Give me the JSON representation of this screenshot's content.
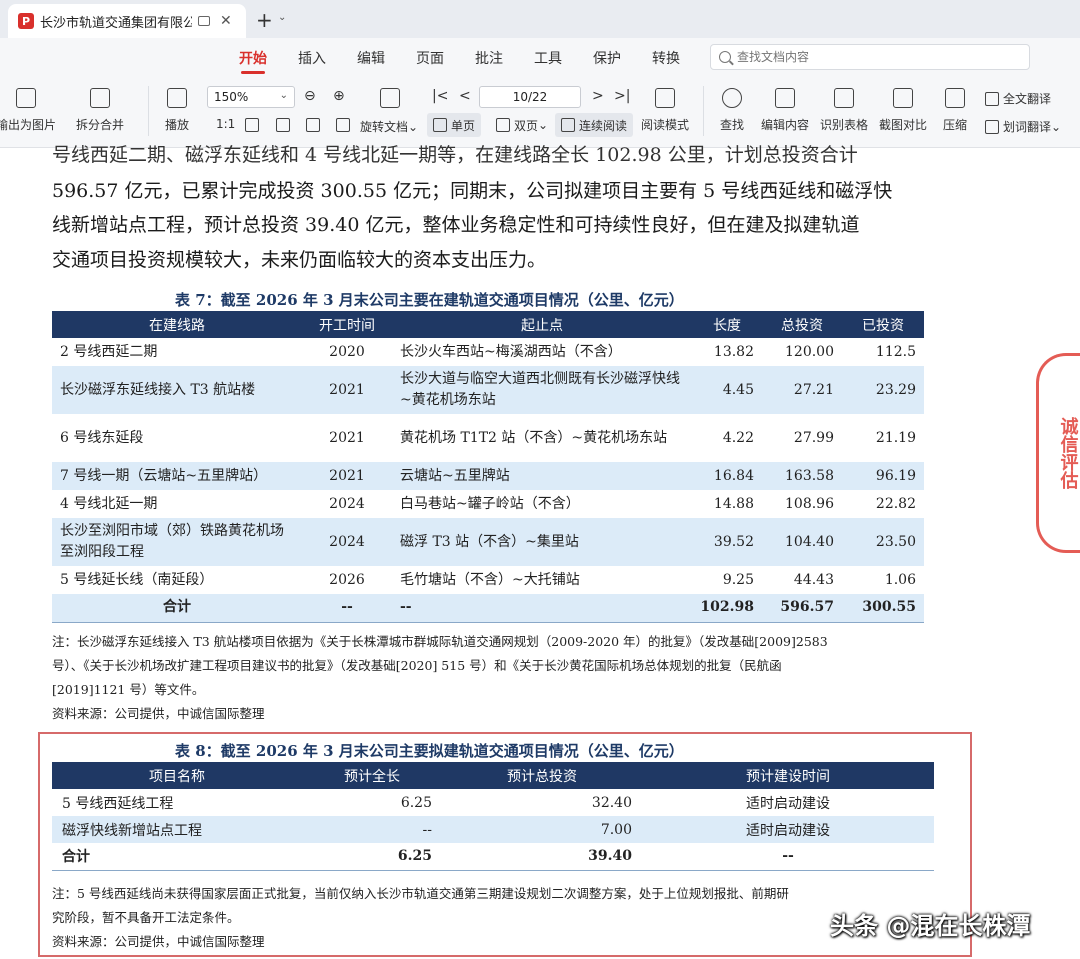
{
  "window": {
    "tab_title": "长沙市轨道交通集团有限公司",
    "close": "✕",
    "new_tab": "+",
    "dropdown": "⌄"
  },
  "menu": {
    "items": [
      "开始",
      "插入",
      "编辑",
      "页面",
      "批注",
      "工具",
      "保护",
      "转换"
    ],
    "active_index": 0,
    "search_placeholder": "查找文档内容"
  },
  "toolbar": {
    "export_image": "输出为图片",
    "split_merge": "拆分合并",
    "play": "播放",
    "zoom": "150%",
    "page": "10/22",
    "rotate_doc": "旋转文档",
    "single_page": "单页",
    "double_page": "双页",
    "continuous": "连续阅读",
    "read_mode": "阅读模式",
    "find": "查找",
    "edit_content": "编辑内容",
    "recognize_table": "识别表格",
    "screenshot_compare": "截图对比",
    "compress": "压缩",
    "full_translate": "全文翻译",
    "word_translate": "划词翻译",
    "ratio": "1:1",
    "chevron_first": "|<",
    "chevron_prev": "<",
    "chevron_next": ">",
    "chevron_last": ">|"
  },
  "document": {
    "para_lines": [
      "号线西延二期、磁浮东延线和 4 号线北延一期等，在建线路全长 102.98 公里，计划总投资合计",
      "596.57 亿元，已累计完成投资 300.55 亿元；同期末，公司拟建项目主要有 5 号线西延线和磁浮快",
      "线新增站点工程，预计总投资 39.40 亿元，整体业务稳定性和可持续性良好，但在建及拟建轨道",
      "交通项目投资规模较大，未来仍面临较大的资本支出压力。"
    ],
    "seal_text": "诚信评估",
    "table7": {
      "title": "表 7：截至 2026 年 3 月末公司主要在建轨道交通项目情况（公里、亿元）",
      "headers": [
        "在建线路",
        "开工时间",
        "起止点",
        "长度",
        "总投资",
        "已投资"
      ],
      "rows": [
        [
          "2 号线西延二期",
          "2020",
          "长沙火车西站~梅溪湖西站（不含）",
          "13.82",
          "120.00",
          "112.5"
        ],
        [
          "长沙磁浮东延线接入 T3 航站楼",
          "2021",
          "长沙大道与临空大道西北侧既有长沙磁浮快线~黄花机场东站",
          "4.45",
          "27.21",
          "23.29"
        ],
        [
          "6 号线东延段",
          "2021",
          "黄花机场 T1T2 站（不含）~黄花机场东站",
          "4.22",
          "27.99",
          "21.19"
        ],
        [
          "7 号线一期（云塘站~五里牌站）",
          "2021",
          "云塘站~五里牌站",
          "16.84",
          "163.58",
          "96.19"
        ],
        [
          "4 号线北延一期",
          "2024",
          "白马巷站~罐子岭站（不含）",
          "14.88",
          "108.96",
          "22.82"
        ],
        [
          "长沙至浏阳市域（郊）铁路黄花机场至浏阳段工程",
          "2024",
          "磁浮 T3 站（不含）~集里站",
          "39.52",
          "104.40",
          "23.50"
        ],
        [
          "5 号线延长线（南延段）",
          "2026",
          "毛竹塘站（不含）~大托铺站",
          "9.25",
          "44.43",
          "1.06"
        ]
      ],
      "total": [
        "合计",
        "--",
        "--",
        "102.98",
        "596.57",
        "300.55"
      ],
      "note_lines": [
        "注：长沙磁浮东延线接入 T3 航站楼项目依据为《关于长株潭城市群城际轨道交通网规划（2009-2020 年）的批复》（发改基础[2009]2583",
        "号）、《关于长沙机场改扩建工程项目建议书的批复》（发改基础[2020] 515 号）和《关于长沙黄花国际机场总体规划的批复（民航函",
        "[2019]1121 号）等文件。"
      ],
      "source": "资料来源：公司提供，中诚信国际整理"
    },
    "table8": {
      "title": "表 8：截至 2026 年 3 月末公司主要拟建轨道交通项目情况（公里、亿元）",
      "headers": [
        "项目名称",
        "预计全长",
        "预计总投资",
        "预计建设时间"
      ],
      "rows": [
        [
          "5 号线西延线工程",
          "6.25",
          "32.40",
          "适时启动建设"
        ],
        [
          "磁浮快线新增站点工程",
          "--",
          "7.00",
          "适时启动建设"
        ]
      ],
      "total": [
        "合计",
        "6.25",
        "39.40",
        "--"
      ],
      "note_lines": [
        "注：5 号线西延线尚未获得国家层面正式批复，当前仅纳入长沙市轨道交通第三期建设规划二次调整方案，处于上位规划报批、前期研",
        "究阶段，暂不具备开工法定条件。"
      ],
      "source": "资料来源：公司提供，中诚信国际整理"
    },
    "watermark": "头条 @混在长株潭"
  }
}
